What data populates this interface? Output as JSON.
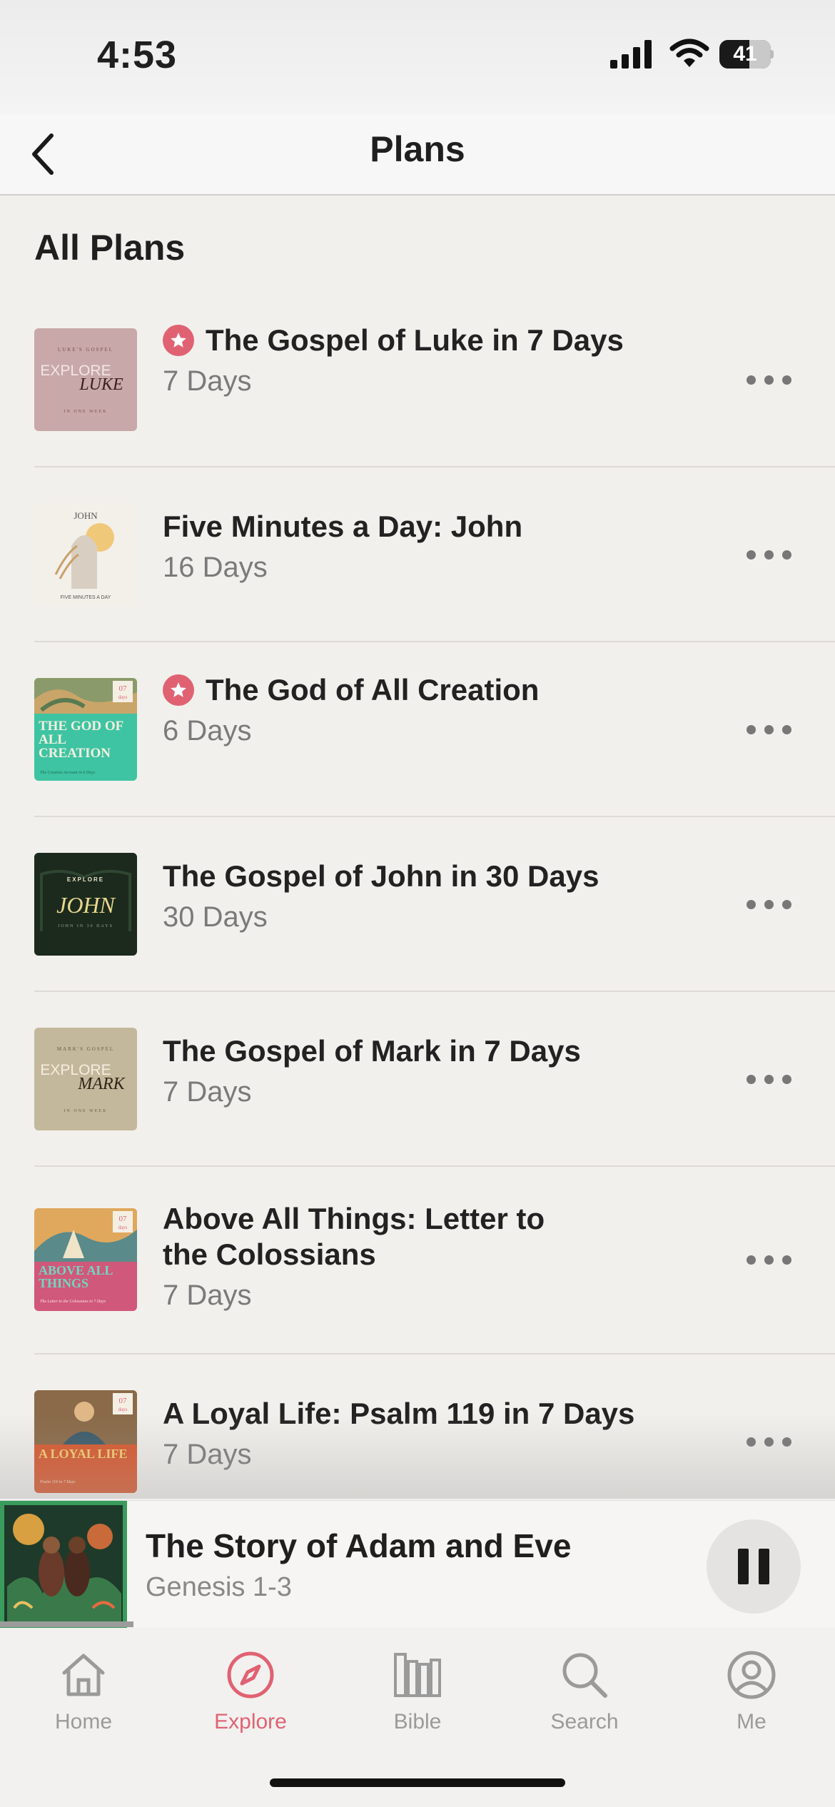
{
  "status_bar": {
    "time": "4:53",
    "battery": "41"
  },
  "nav": {
    "title": "Plans"
  },
  "section_title": "All Plans",
  "plans": [
    {
      "title": "The Gospel of Luke in 7 Days",
      "days": "7 Days",
      "starred": true,
      "cover": {
        "top": "LUKE'S GOSPEL",
        "big": "EXPLORE",
        "name": "LUKE",
        "bottom": "IN ONE WEEK"
      }
    },
    {
      "title": "Five Minutes a Day: John",
      "days": "16 Days",
      "starred": false,
      "cover": {
        "top": "JOHN",
        "bottom": "FIVE MINUTES A DAY"
      }
    },
    {
      "title": "The God of All Creation",
      "days": "6 Days",
      "starred": true,
      "cover": {
        "badge_num": "07",
        "badge_word": "days",
        "name": "THE GOD OF ALL CREATION",
        "sub": "The Creation Account in 6 Days"
      }
    },
    {
      "title": "The Gospel of John in 30 Days",
      "days": "30 Days",
      "starred": false,
      "cover": {
        "top": "EXPLORE",
        "name": "JOHN",
        "bottom": "JOHN IN 30 DAYS"
      }
    },
    {
      "title": "The Gospel of Mark in 7 Days",
      "days": "7 Days",
      "starred": false,
      "cover": {
        "top": "MARK'S GOSPEL",
        "big": "EXPLORE",
        "name": "MARK",
        "bottom": "IN ONE WEEK"
      }
    },
    {
      "title_line1": "Above All Things: Letter to",
      "title_line2": "the Colossians",
      "days": "7 Days",
      "starred": false,
      "cover": {
        "badge_num": "07",
        "badge_word": "days",
        "name": "ABOVE ALL THINGS",
        "sub": "The Letter to the Colossians in 7 Days"
      }
    },
    {
      "title": "A Loyal Life: Psalm 119 in 7 Days",
      "days": "7 Days",
      "starred": false,
      "cover": {
        "badge_num": "07",
        "badge_word": "days",
        "name": "A LOYAL LIFE",
        "sub": "Psalm 119 in 7 Days"
      }
    }
  ],
  "player": {
    "title": "The Story of Adam and Eve",
    "subtitle": "Genesis 1-3",
    "progress": 0.16
  },
  "tabs": [
    {
      "label": "Home",
      "icon": "home-icon"
    },
    {
      "label": "Explore",
      "icon": "compass-icon",
      "active": true
    },
    {
      "label": "Bible",
      "icon": "books-icon"
    },
    {
      "label": "Search",
      "icon": "search-icon"
    },
    {
      "label": "Me",
      "icon": "person-circle-icon"
    }
  ],
  "colors": {
    "accent": "#e06272",
    "background": "#f2f0ec",
    "secondary_text": "#7a7a7a"
  }
}
